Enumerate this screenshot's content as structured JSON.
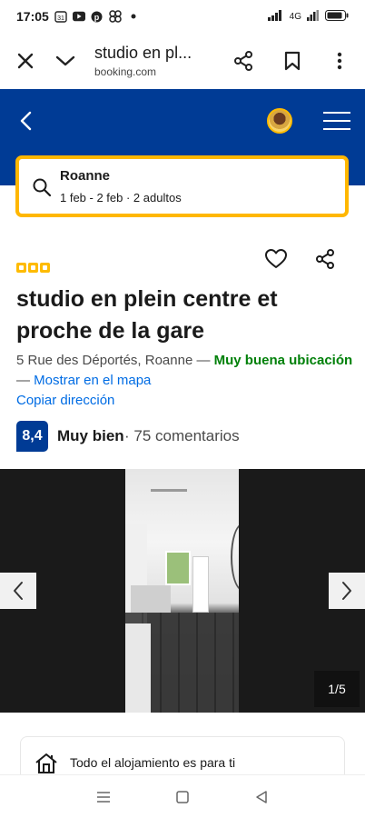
{
  "statusbar": {
    "time": "17:05",
    "calendar_day": "31",
    "network": "4G",
    "icons": [
      "calendar-icon",
      "youtube-icon",
      "pinterest-icon",
      "pinwheel-icon",
      "dot-icon",
      "signal-icon",
      "wifi-icon",
      "battery-icon"
    ]
  },
  "browser": {
    "page_title": "studio en pl...",
    "domain": "booking.com"
  },
  "search": {
    "destination": "Roanne",
    "details": "1 feb - 2 feb · 2 adultos"
  },
  "property": {
    "star_count": 3,
    "title": "studio en plein centre et proche de la gare",
    "address": "5 Rue des Déportés, Roanne",
    "dash": " — ",
    "location_badge": "Muy buena ubicación",
    "map_prefix": "— ",
    "map_link": "Mostrar en el mapa",
    "copy_link": "Copiar dirección",
    "score": "8,4",
    "score_word": "Muy bien",
    "reviews": "· 75 comentarios"
  },
  "gallery": {
    "counter": "1/5"
  },
  "features": {
    "first": "Todo el alojamiento es para ti"
  },
  "colors": {
    "brand_blue": "#003b95",
    "accent_yellow": "#ffb700",
    "link_blue": "#006ce4",
    "good_green": "#008009"
  }
}
